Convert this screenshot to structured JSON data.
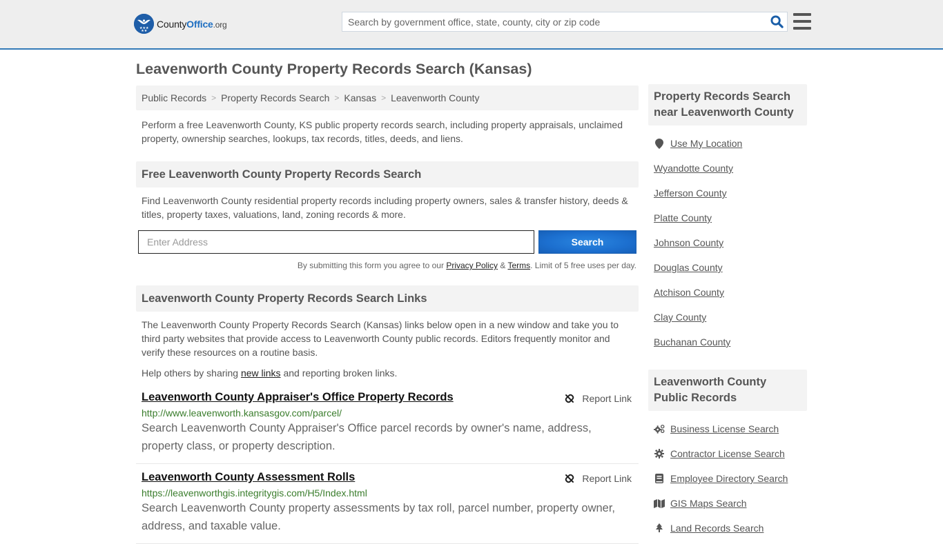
{
  "header": {
    "logo": {
      "county": "County",
      "office": "Office",
      "org": ".org"
    },
    "search_placeholder": "Search by government office, state, county, city or zip code"
  },
  "page_title": "Leavenworth County Property Records Search (Kansas)",
  "breadcrumb": [
    "Public Records",
    "Property Records Search",
    "Kansas",
    "Leavenworth County"
  ],
  "intro": "Perform a free Leavenworth County, KS public property records search, including property appraisals, unclaimed property, ownership searches, lookups, tax records, titles, deeds, and liens.",
  "free_search": {
    "heading": "Free Leavenworth County Property Records Search",
    "text": "Find Leavenworth County residential property records including property owners, sales & transfer history, deeds & titles, property taxes, valuations, land, zoning records & more.",
    "address_placeholder": "Enter Address",
    "button": "Search",
    "disclaimer_pre": "By submitting this form you agree to our ",
    "privacy": "Privacy Policy",
    "amp": " & ",
    "terms": "Terms",
    "disclaimer_post": ". Limit of 5 free uses per day."
  },
  "links_section": {
    "heading": "Leavenworth County Property Records Search Links",
    "text": "The Leavenworth County Property Records Search (Kansas) links below open in a new window and take you to third party websites that provide access to Leavenworth County public records. Editors frequently monitor and verify these resources on a routine basis.",
    "help_pre": "Help others by sharing ",
    "help_link": "new links",
    "help_post": " and reporting broken links.",
    "report_label": "Report Link",
    "items": [
      {
        "title": "Leavenworth County Appraiser's Office Property Records",
        "url": "http://www.leavenworth.kansasgov.com/parcel/",
        "description": "Search Leavenworth County Appraiser's Office parcel records by owner's name, address, property class, or property description."
      },
      {
        "title": "Leavenworth County Assessment Rolls",
        "url": "https://leavenworthgis.integritygis.com/H5/Index.html",
        "description": "Search Leavenworth County property assessments by tax roll, parcel number, property owner, address, and taxable value."
      }
    ]
  },
  "sidebar": {
    "nearby_heading": "Property Records Search near Leavenworth County",
    "use_location": "Use My Location",
    "nearby": [
      "Wyandotte County",
      "Jefferson County",
      "Platte County",
      "Johnson County",
      "Douglas County",
      "Atchison County",
      "Clay County",
      "Buchanan County"
    ],
    "public_heading": "Leavenworth County Public Records",
    "public_records": [
      {
        "label": "Business License Search",
        "icon": "gears-icon"
      },
      {
        "label": "Contractor License Search",
        "icon": "gear-icon"
      },
      {
        "label": "Employee Directory Search",
        "icon": "book-icon"
      },
      {
        "label": "GIS Maps Search",
        "icon": "map-icon"
      },
      {
        "label": "Land Records Search",
        "icon": "tree-icon"
      }
    ]
  },
  "colors": {
    "accent": "#337ab7",
    "button": "#1c6fcf",
    "url_green": "#3a7d2c",
    "header_bg": "#eeeeee",
    "panel_bg": "#f3f3f3"
  }
}
